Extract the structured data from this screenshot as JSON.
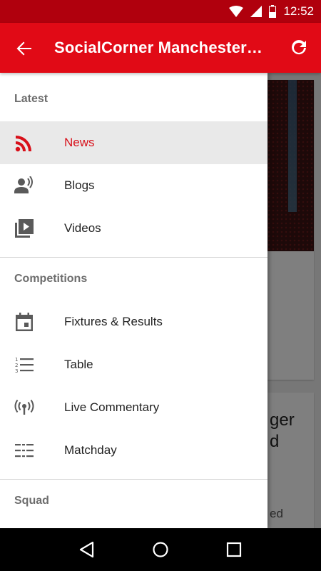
{
  "status_bar": {
    "time": "12:52"
  },
  "toolbar": {
    "title": "SocialCorner Manchester…"
  },
  "background": {
    "headline_partial": "ger\nd",
    "meta_partial": "ed"
  },
  "drawer": {
    "sections": [
      {
        "heading": "Latest",
        "items": [
          {
            "label": "News",
            "icon": "rss-icon",
            "active": true
          },
          {
            "label": "Blogs",
            "icon": "person-voice-icon",
            "active": false
          },
          {
            "label": "Videos",
            "icon": "video-library-icon",
            "active": false
          }
        ]
      },
      {
        "heading": "Competitions",
        "items": [
          {
            "label": "Fixtures & Results",
            "icon": "calendar-icon",
            "active": false
          },
          {
            "label": "Table",
            "icon": "numbered-list-icon",
            "active": false
          },
          {
            "label": "Live Commentary",
            "icon": "broadcast-icon",
            "active": false
          },
          {
            "label": "Matchday",
            "icon": "list-icon",
            "active": false
          }
        ]
      },
      {
        "heading": "Squad",
        "items": []
      }
    ]
  },
  "colors": {
    "primary": "#e10a16",
    "status_bar": "#b0000d",
    "active_text": "#d8101a",
    "icon_gray": "#5a5a5a"
  }
}
